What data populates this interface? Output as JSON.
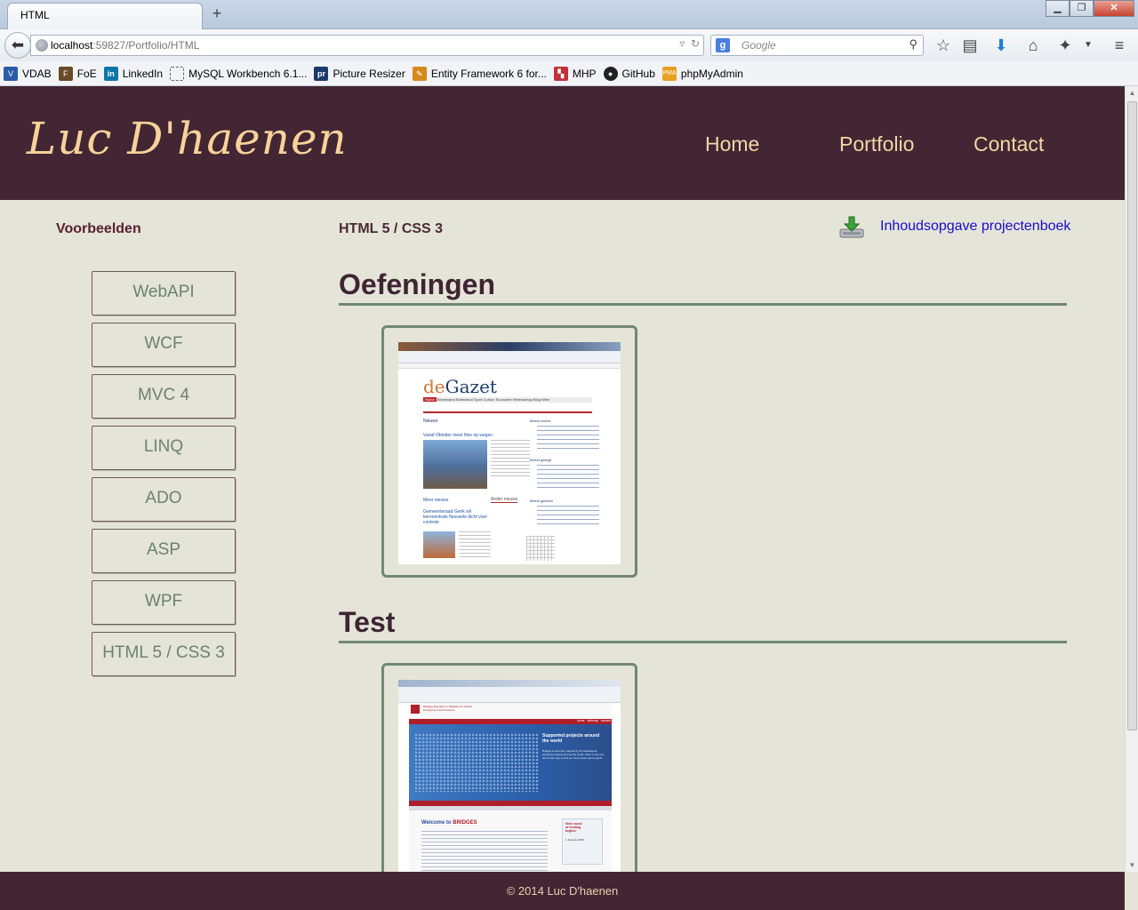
{
  "browser": {
    "tab_title": "HTML",
    "url_host": "localhost",
    "url_rest": ":59827/Portfolio/HTML",
    "search_placeholder": "Google",
    "search_engine_letter": "g",
    "bookmarks": [
      "VDAB",
      "FoE",
      "LinkedIn",
      "MySQL Workbench 6.1...",
      "Picture Resizer",
      "Entity Framework 6 for...",
      "MHP",
      "GitHub",
      "phpMyAdmin"
    ]
  },
  "header": {
    "logo": "Luc D'haenen",
    "nav": [
      "Home",
      "Portfolio",
      "Contact"
    ]
  },
  "sidebar": {
    "title": "Voorbeelden",
    "items": [
      "WebAPI",
      "WCF",
      "MVC 4",
      "LINQ",
      "ADO",
      "ASP",
      "WPF",
      "HTML 5 / CSS 3"
    ]
  },
  "main": {
    "breadcrumb": "HTML 5 / CSS 3",
    "download_link": "Inhoudsopgave projectenboek",
    "sections": [
      {
        "title": "Oefeningen",
        "screenshot": {
          "site_title_prefix": "de",
          "site_title": "Gazet",
          "menu": [
            "Home",
            "Binnenland",
            "Buitenland",
            "Sport",
            "Cultuur",
            "Economie",
            "Wetenschap",
            "Blog",
            "Weer"
          ],
          "heading": "Nieuws",
          "article_title": "Vanaf Oktober meer files op wegen",
          "more_news": "Meer nieuws",
          "other_news": "Ander nieuws",
          "article2_title": "Gemeenteraad Genk wil kernoentrale fluessele dicht voor controle",
          "side_heads": [
            "Meest recent",
            "Meest gelegd",
            "Meest gelezen"
          ]
        }
      },
      {
        "title": "Test",
        "screenshot": {
          "site_brand": "BRIDGES",
          "site_tagline": "Bridging Research in Statistics for Global Environment and Customs",
          "nav": [
            "home",
            "sitemap",
            "contact"
          ],
          "feature_title": "Supported projects around the world",
          "feature_text": "Bridges is currently supporting 11 translational research projects around the world. Click on the red dot on the map to find out more about each project.",
          "welcome_prefix": "Welcome to",
          "welcome_brand": "BRIDGES",
          "funding_title": "Next round of funding begins:",
          "funding_date": "1 January 2009"
        }
      }
    ]
  },
  "footer": {
    "text": "© 2014 Luc D'haenen"
  },
  "colors": {
    "header_bg": "#432633",
    "page_bg": "#e5e4d8",
    "accent": "#718873",
    "logo": "#f7d29a",
    "link": "#1a0dcd"
  }
}
